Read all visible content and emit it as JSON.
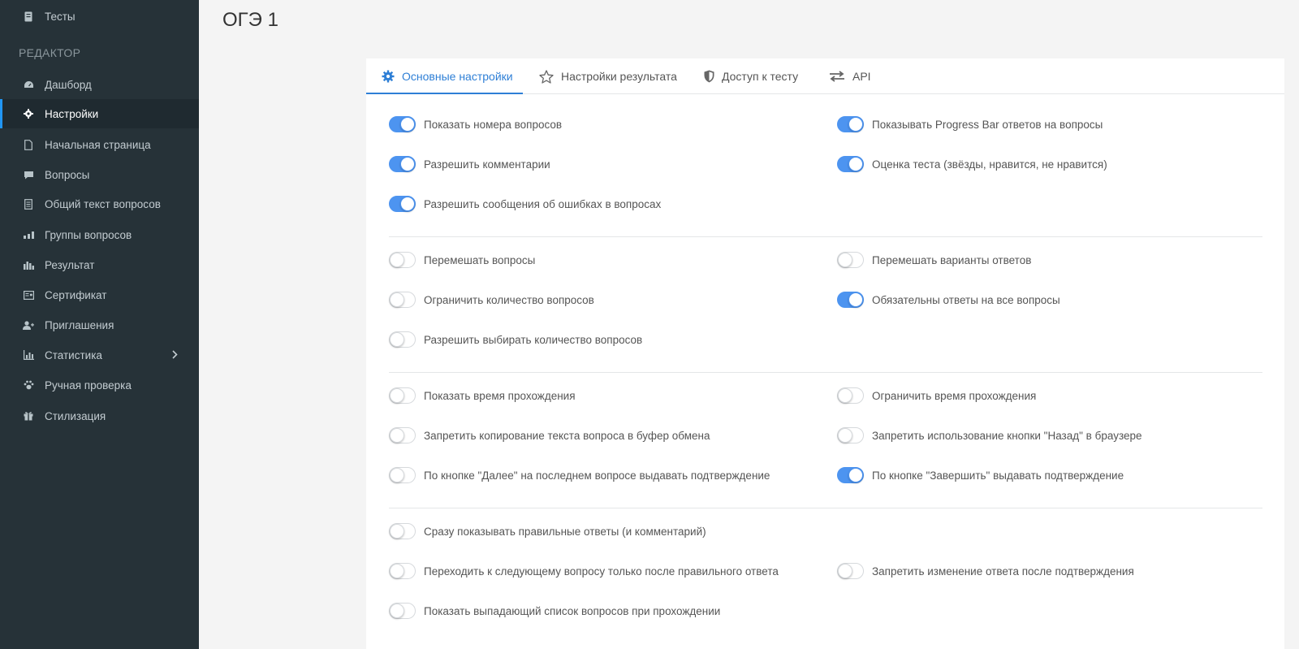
{
  "sidebar": {
    "top_item": {
      "label": "Тесты",
      "icon": "book-icon"
    },
    "section_title": "РЕДАКТОР",
    "items": [
      {
        "label": "Дашборд",
        "icon": "dashboard-icon"
      },
      {
        "label": "Настройки",
        "icon": "gear-icon"
      },
      {
        "label": "Начальная страница",
        "icon": "page-icon"
      },
      {
        "label": "Вопросы",
        "icon": "question-icon"
      },
      {
        "label": "Общий текст вопросов",
        "icon": "document-icon"
      },
      {
        "label": "Группы вопросов",
        "icon": "groups-icon"
      },
      {
        "label": "Результат",
        "icon": "bar-chart-icon"
      },
      {
        "label": "Сертификат",
        "icon": "certificate-icon"
      },
      {
        "label": "Приглашения",
        "icon": "user-add-icon"
      },
      {
        "label": "Статистика",
        "icon": "chart-icon"
      },
      {
        "label": "Ручная проверка",
        "icon": "paw-icon"
      },
      {
        "label": "Стилизация",
        "icon": "gift-icon"
      }
    ]
  },
  "page": {
    "title": "ОГЭ 1"
  },
  "tabs": [
    {
      "label": "Основные настройки",
      "icon": "gear-icon"
    },
    {
      "label": "Настройки результата",
      "icon": "star-icon"
    },
    {
      "label": "Доступ к тесту",
      "icon": "shield-icon"
    },
    {
      "label": "API",
      "icon": "exchange-icon"
    }
  ],
  "colors": {
    "accent": "#2e7fd6",
    "toggle_on": "#4d94f0",
    "sidebar_bg": "#263238"
  },
  "settings": {
    "g1": [
      {
        "label": "Показать номера вопросов",
        "on": true
      },
      {
        "label": "Показывать Progress Bar ответов на вопросы",
        "on": true
      },
      {
        "label": "Разрешить комментарии",
        "on": true
      },
      {
        "label": "Оценка теста (звёзды, нравится, не нравится)",
        "on": true
      },
      {
        "label": "Разрешить сообщения об ошибках в вопросах",
        "on": true
      }
    ],
    "g2": [
      {
        "label": "Перемешать вопросы",
        "on": false
      },
      {
        "label": "Перемешать варианты ответов",
        "on": false
      },
      {
        "label": "Ограничить количество вопросов",
        "on": false
      },
      {
        "label": "Обязательны ответы на все вопросы",
        "on": true
      },
      {
        "label": "Разрешить выбирать количество вопросов",
        "on": false
      }
    ],
    "g3": [
      {
        "label": "Показать время прохождения",
        "on": false
      },
      {
        "label": "Ограничить время прохождения",
        "on": false
      },
      {
        "label": "Запретить копирование текста вопроса в буфер обмена",
        "on": false
      },
      {
        "label": "Запретить использование кнопки \"Назад\" в браузере",
        "on": false
      },
      {
        "label": "По кнопке \"Далее\" на последнем вопросе выдавать подтверждение",
        "on": false
      },
      {
        "label": "По кнопке \"Завершить\" выдавать подтверждение",
        "on": true
      }
    ],
    "g4": [
      {
        "label": "Сразу показывать правильные ответы (и комментарий)",
        "on": false
      },
      {
        "label": "Переходить к следующему вопросу только после правильного ответа",
        "on": false
      },
      {
        "label": "Запретить изменение ответа после подтверждения",
        "on": false
      },
      {
        "label": "Показать выпадающий список вопросов при прохождении",
        "on": false
      }
    ]
  }
}
